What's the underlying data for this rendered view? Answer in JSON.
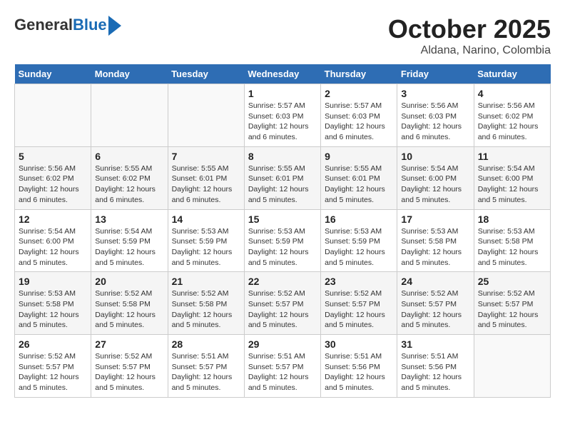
{
  "header": {
    "logo_line1": "General",
    "logo_line2": "Blue",
    "title": "October 2025",
    "subtitle": "Aldana, Narino, Colombia"
  },
  "calendar": {
    "days_of_week": [
      "Sunday",
      "Monday",
      "Tuesday",
      "Wednesday",
      "Thursday",
      "Friday",
      "Saturday"
    ],
    "weeks": [
      [
        {
          "day": "",
          "info": ""
        },
        {
          "day": "",
          "info": ""
        },
        {
          "day": "",
          "info": ""
        },
        {
          "day": "1",
          "info": "Sunrise: 5:57 AM\nSunset: 6:03 PM\nDaylight: 12 hours and 6 minutes."
        },
        {
          "day": "2",
          "info": "Sunrise: 5:57 AM\nSunset: 6:03 PM\nDaylight: 12 hours and 6 minutes."
        },
        {
          "day": "3",
          "info": "Sunrise: 5:56 AM\nSunset: 6:03 PM\nDaylight: 12 hours and 6 minutes."
        },
        {
          "day": "4",
          "info": "Sunrise: 5:56 AM\nSunset: 6:02 PM\nDaylight: 12 hours and 6 minutes."
        }
      ],
      [
        {
          "day": "5",
          "info": "Sunrise: 5:56 AM\nSunset: 6:02 PM\nDaylight: 12 hours and 6 minutes."
        },
        {
          "day": "6",
          "info": "Sunrise: 5:55 AM\nSunset: 6:02 PM\nDaylight: 12 hours and 6 minutes."
        },
        {
          "day": "7",
          "info": "Sunrise: 5:55 AM\nSunset: 6:01 PM\nDaylight: 12 hours and 6 minutes."
        },
        {
          "day": "8",
          "info": "Sunrise: 5:55 AM\nSunset: 6:01 PM\nDaylight: 12 hours and 5 minutes."
        },
        {
          "day": "9",
          "info": "Sunrise: 5:55 AM\nSunset: 6:01 PM\nDaylight: 12 hours and 5 minutes."
        },
        {
          "day": "10",
          "info": "Sunrise: 5:54 AM\nSunset: 6:00 PM\nDaylight: 12 hours and 5 minutes."
        },
        {
          "day": "11",
          "info": "Sunrise: 5:54 AM\nSunset: 6:00 PM\nDaylight: 12 hours and 5 minutes."
        }
      ],
      [
        {
          "day": "12",
          "info": "Sunrise: 5:54 AM\nSunset: 6:00 PM\nDaylight: 12 hours and 5 minutes."
        },
        {
          "day": "13",
          "info": "Sunrise: 5:54 AM\nSunset: 5:59 PM\nDaylight: 12 hours and 5 minutes."
        },
        {
          "day": "14",
          "info": "Sunrise: 5:53 AM\nSunset: 5:59 PM\nDaylight: 12 hours and 5 minutes."
        },
        {
          "day": "15",
          "info": "Sunrise: 5:53 AM\nSunset: 5:59 PM\nDaylight: 12 hours and 5 minutes."
        },
        {
          "day": "16",
          "info": "Sunrise: 5:53 AM\nSunset: 5:59 PM\nDaylight: 12 hours and 5 minutes."
        },
        {
          "day": "17",
          "info": "Sunrise: 5:53 AM\nSunset: 5:58 PM\nDaylight: 12 hours and 5 minutes."
        },
        {
          "day": "18",
          "info": "Sunrise: 5:53 AM\nSunset: 5:58 PM\nDaylight: 12 hours and 5 minutes."
        }
      ],
      [
        {
          "day": "19",
          "info": "Sunrise: 5:53 AM\nSunset: 5:58 PM\nDaylight: 12 hours and 5 minutes."
        },
        {
          "day": "20",
          "info": "Sunrise: 5:52 AM\nSunset: 5:58 PM\nDaylight: 12 hours and 5 minutes."
        },
        {
          "day": "21",
          "info": "Sunrise: 5:52 AM\nSunset: 5:58 PM\nDaylight: 12 hours and 5 minutes."
        },
        {
          "day": "22",
          "info": "Sunrise: 5:52 AM\nSunset: 5:57 PM\nDaylight: 12 hours and 5 minutes."
        },
        {
          "day": "23",
          "info": "Sunrise: 5:52 AM\nSunset: 5:57 PM\nDaylight: 12 hours and 5 minutes."
        },
        {
          "day": "24",
          "info": "Sunrise: 5:52 AM\nSunset: 5:57 PM\nDaylight: 12 hours and 5 minutes."
        },
        {
          "day": "25",
          "info": "Sunrise: 5:52 AM\nSunset: 5:57 PM\nDaylight: 12 hours and 5 minutes."
        }
      ],
      [
        {
          "day": "26",
          "info": "Sunrise: 5:52 AM\nSunset: 5:57 PM\nDaylight: 12 hours and 5 minutes."
        },
        {
          "day": "27",
          "info": "Sunrise: 5:52 AM\nSunset: 5:57 PM\nDaylight: 12 hours and 5 minutes."
        },
        {
          "day": "28",
          "info": "Sunrise: 5:51 AM\nSunset: 5:57 PM\nDaylight: 12 hours and 5 minutes."
        },
        {
          "day": "29",
          "info": "Sunrise: 5:51 AM\nSunset: 5:57 PM\nDaylight: 12 hours and 5 minutes."
        },
        {
          "day": "30",
          "info": "Sunrise: 5:51 AM\nSunset: 5:56 PM\nDaylight: 12 hours and 5 minutes."
        },
        {
          "day": "31",
          "info": "Sunrise: 5:51 AM\nSunset: 5:56 PM\nDaylight: 12 hours and 5 minutes."
        },
        {
          "day": "",
          "info": ""
        }
      ]
    ]
  }
}
